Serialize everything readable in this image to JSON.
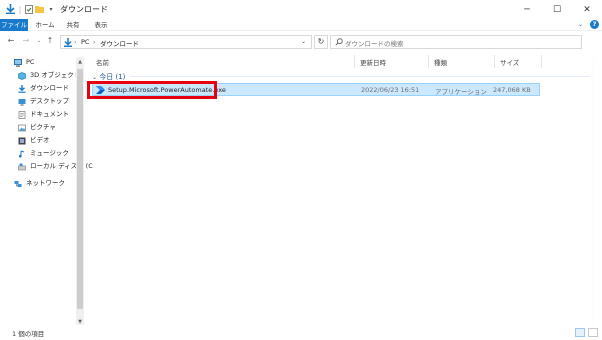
{
  "window": {
    "title": "ダウンロード",
    "minimize": "─",
    "maximize": "☐",
    "close": "✕"
  },
  "ribbon": {
    "tabs": [
      "ファイル",
      "ホーム",
      "共有",
      "表示"
    ]
  },
  "address": {
    "segments": [
      "PC",
      "ダウンロード"
    ],
    "separator": "›"
  },
  "search": {
    "placeholder": "ダウンロードの検索"
  },
  "nav": {
    "items": [
      {
        "label": "PC",
        "icon": "pc-icon"
      },
      {
        "label": "3D オブジェクト",
        "icon": "3d-objects-icon"
      },
      {
        "label": "ダウンロード",
        "icon": "download-icon"
      },
      {
        "label": "デスクトップ",
        "icon": "desktop-icon"
      },
      {
        "label": "ドキュメント",
        "icon": "documents-icon"
      },
      {
        "label": "ピクチャ",
        "icon": "pictures-icon"
      },
      {
        "label": "ビデオ",
        "icon": "videos-icon"
      },
      {
        "label": "ミュージック",
        "icon": "music-icon"
      },
      {
        "label": "ローカル ディスク (C",
        "icon": "local-disk-icon"
      },
      {
        "label": "ネットワーク",
        "icon": "network-icon"
      }
    ]
  },
  "columns": {
    "name": "名前",
    "modified": "更新日時",
    "type": "種類",
    "size": "サイズ"
  },
  "group": {
    "label": "今日 (1)"
  },
  "files": [
    {
      "name": "Setup.Microsoft.PowerAutomate.exe",
      "modified": "2022/06/23 16:51",
      "type": "アプリケーション",
      "size": "247,068 KB"
    }
  ],
  "status": {
    "item_count": "1 個の項目"
  },
  "colors": {
    "accent": "#1979ca",
    "selection": "#cce8ff",
    "highlight": "#e60012"
  }
}
